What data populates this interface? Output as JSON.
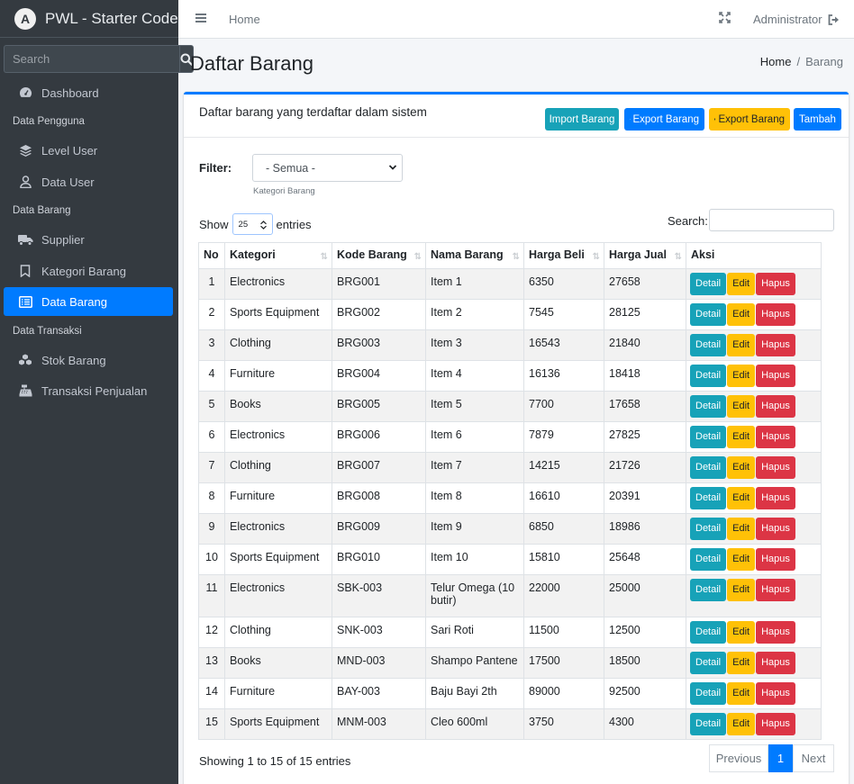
{
  "brand": {
    "title": "PWL - Starter Code",
    "logo_letter": "A"
  },
  "sidebar": {
    "search_placeholder": "Search",
    "items": [
      {
        "type": "item",
        "label": "Dashboard",
        "icon": "dashboard-icon",
        "active": false
      },
      {
        "type": "header",
        "label": "Data Pengguna"
      },
      {
        "type": "item",
        "label": "Level User",
        "icon": "layers-icon",
        "active": false
      },
      {
        "type": "item",
        "label": "Data User",
        "icon": "user-icon",
        "active": false
      },
      {
        "type": "header",
        "label": "Data Barang"
      },
      {
        "type": "item",
        "label": "Supplier",
        "icon": "truck-icon",
        "active": false
      },
      {
        "type": "item",
        "label": "Kategori Barang",
        "icon": "bookmark-icon",
        "active": false
      },
      {
        "type": "item",
        "label": "Data Barang",
        "icon": "list-icon",
        "active": true
      },
      {
        "type": "header",
        "label": "Data Transaksi"
      },
      {
        "type": "item",
        "label": "Stok Barang",
        "icon": "cubes-icon",
        "active": false
      },
      {
        "type": "item",
        "label": "Transaksi Penjualan",
        "icon": "cash-register-icon",
        "active": false
      }
    ]
  },
  "topbar": {
    "home": "Home",
    "user": "Administrator"
  },
  "page": {
    "title": "Daftar Barang",
    "breadcrumb": [
      "Home",
      "Barang"
    ]
  },
  "card": {
    "title": "Daftar barang yang terdaftar dalam sistem",
    "buttons": {
      "import": "Import Barang",
      "export_excel": "Export Barang",
      "export_pdf": "Export Barang",
      "add": "Tambah"
    },
    "filter_label": "Filter:",
    "filter_value": "- Semua -",
    "filter_help": "Kategori Barang",
    "show_label": "Show",
    "page_length": "25",
    "entries_label": "entries",
    "search_label": "Search:"
  },
  "table": {
    "columns": [
      "No",
      "Kategori",
      "Kode Barang",
      "Nama Barang",
      "Harga Beli",
      "Harga Jual",
      "Aksi"
    ],
    "action_labels": {
      "detail": "Detail",
      "edit": "Edit",
      "delete": "Hapus"
    },
    "rows": [
      {
        "no": "1",
        "kategori": "Electronics",
        "kode": "BRG001",
        "nama": "Item 1",
        "beli": "6350",
        "jual": "27658"
      },
      {
        "no": "2",
        "kategori": "Sports Equipment",
        "kode": "BRG002",
        "nama": "Item 2",
        "beli": "7545",
        "jual": "28125"
      },
      {
        "no": "3",
        "kategori": "Clothing",
        "kode": "BRG003",
        "nama": "Item 3",
        "beli": "16543",
        "jual": "21840"
      },
      {
        "no": "4",
        "kategori": "Furniture",
        "kode": "BRG004",
        "nama": "Item 4",
        "beli": "16136",
        "jual": "18418"
      },
      {
        "no": "5",
        "kategori": "Books",
        "kode": "BRG005",
        "nama": "Item 5",
        "beli": "7700",
        "jual": "17658"
      },
      {
        "no": "6",
        "kategori": "Electronics",
        "kode": "BRG006",
        "nama": "Item 6",
        "beli": "7879",
        "jual": "27825"
      },
      {
        "no": "7",
        "kategori": "Clothing",
        "kode": "BRG007",
        "nama": "Item 7",
        "beli": "14215",
        "jual": "21726"
      },
      {
        "no": "8",
        "kategori": "Furniture",
        "kode": "BRG008",
        "nama": "Item 8",
        "beli": "16610",
        "jual": "20391"
      },
      {
        "no": "9",
        "kategori": "Electronics",
        "kode": "BRG009",
        "nama": "Item 9",
        "beli": "6850",
        "jual": "18986"
      },
      {
        "no": "10",
        "kategori": "Sports Equipment",
        "kode": "BRG010",
        "nama": "Item 10",
        "beli": "15810",
        "jual": "25648"
      },
      {
        "no": "11",
        "kategori": "Electronics",
        "kode": "SBK-003",
        "nama": "Telur Omega (10 butir)",
        "beli": "22000",
        "jual": "25000"
      },
      {
        "no": "12",
        "kategori": "Clothing",
        "kode": "SNK-003",
        "nama": "Sari Roti",
        "beli": "11500",
        "jual": "12500"
      },
      {
        "no": "13",
        "kategori": "Books",
        "kode": "MND-003",
        "nama": "Shampo Pantene",
        "beli": "17500",
        "jual": "18500"
      },
      {
        "no": "14",
        "kategori": "Furniture",
        "kode": "BAY-003",
        "nama": "Baju Bayi 2th",
        "beli": "89000",
        "jual": "92500"
      },
      {
        "no": "15",
        "kategori": "Sports Equipment",
        "kode": "MNM-003",
        "nama": "Cleo 600ml",
        "beli": "3750",
        "jual": "4300"
      }
    ]
  },
  "footer": {
    "info": "Showing 1 to 15 of 15 entries",
    "previous": "Previous",
    "page": "1",
    "next": "Next"
  }
}
